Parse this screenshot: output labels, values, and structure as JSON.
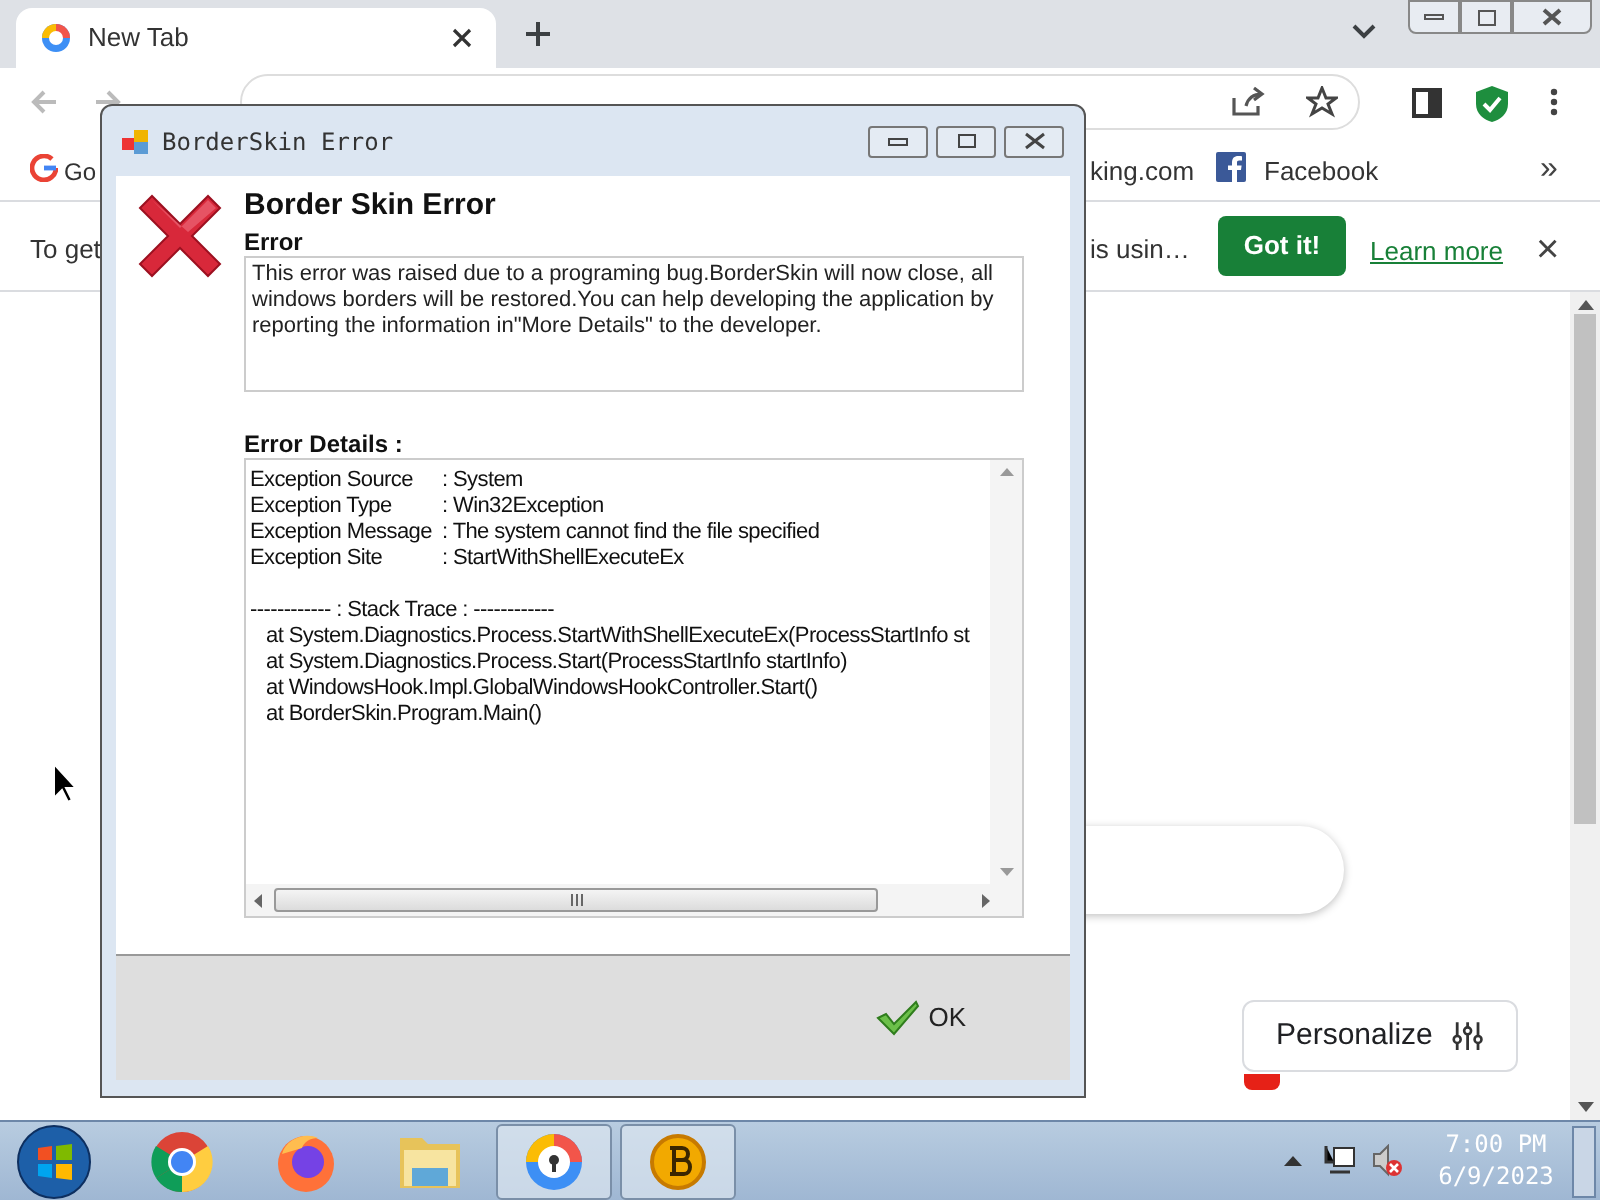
{
  "browser": {
    "tabs": [
      {
        "title": "New Tab",
        "selected": true
      }
    ],
    "bookmarks": [
      {
        "label": "Go"
      },
      {
        "label": "king.com"
      },
      {
        "label": "Facebook"
      }
    ],
    "bookmarks_more": "»"
  },
  "infobar": {
    "text_start": "To get",
    "text_end": "is usin…",
    "button": "Got it!",
    "link": "Learn more",
    "close": "×"
  },
  "personalize": "Personalize",
  "dialog": {
    "title": "BorderSkin Error",
    "heading": "Border Skin Error",
    "section": "Error",
    "message": "This error was raised due to a programing bug.BorderSkin will now close, all windows borders will be restored.You can help developing the application by reporting the information in\"More Details\" to the developer.",
    "details_label": "Error Details :",
    "fields": [
      {
        "label": "Exception Source",
        "value": ": System"
      },
      {
        "label": "Exception Type",
        "value": ": Win32Exception"
      },
      {
        "label": "Exception Message",
        "value": ": The system cannot find the file specified"
      },
      {
        "label": "Exception Site",
        "value": ": StartWithShellExecuteEx"
      }
    ],
    "trace_header": "------------ : Stack Trace : ------------",
    "trace": [
      "at System.Diagnostics.Process.StartWithShellExecuteEx(ProcessStartInfo st",
      "at System.Diagnostics.Process.Start(ProcessStartInfo startInfo)",
      "at WindowsHook.Impl.GlobalWindowsHookController.Start()",
      "at BorderSkin.Program.Main()"
    ],
    "ok": "OK"
  },
  "taskbar": {
    "apps": [
      {
        "kind": "chrome",
        "active": false
      },
      {
        "kind": "firefox",
        "active": false
      },
      {
        "kind": "folder",
        "active": false
      },
      {
        "kind": "browser",
        "active": true
      },
      {
        "kind": "coin",
        "active": true
      }
    ],
    "time": "7:00 PM",
    "date": "6/9/2023"
  }
}
